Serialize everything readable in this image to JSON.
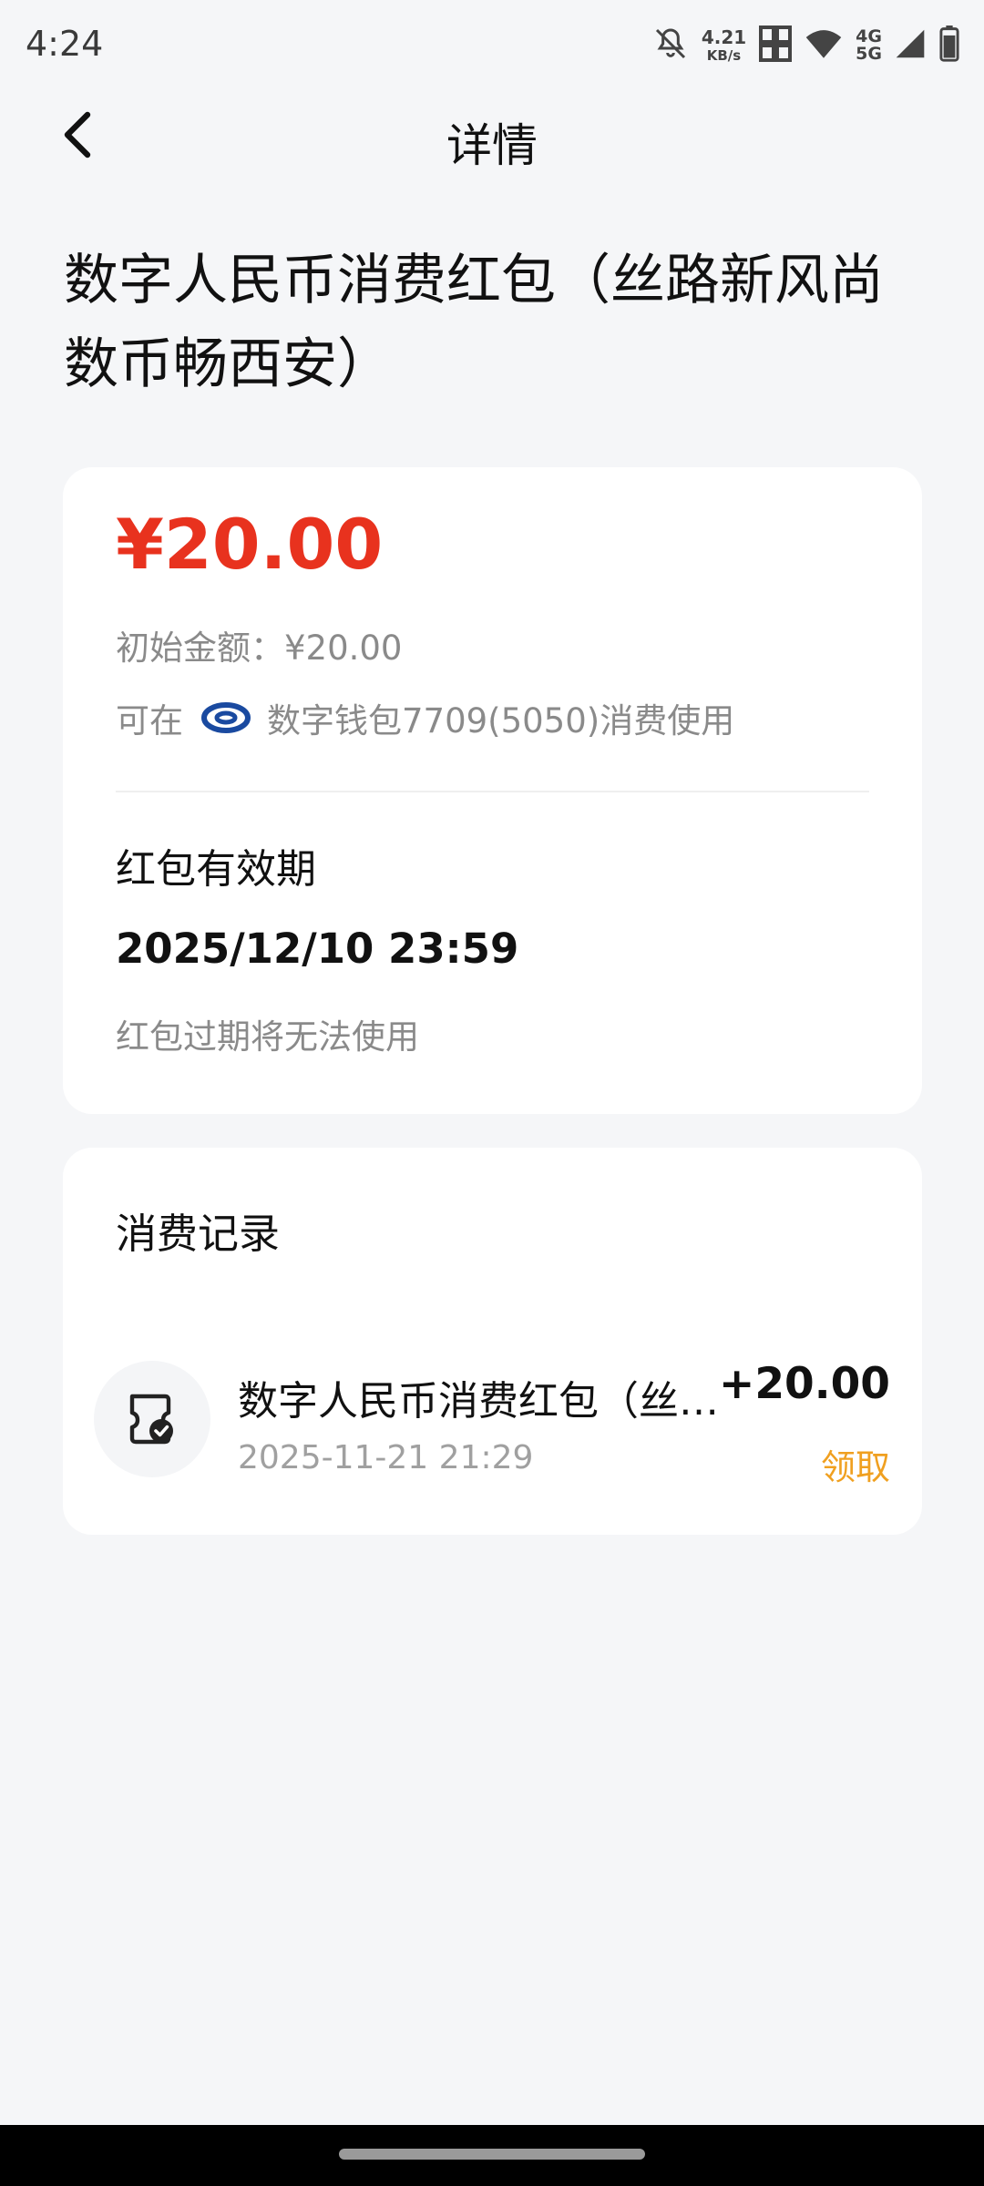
{
  "status_bar": {
    "time": "4:24",
    "net_speed_value": "4.21",
    "net_speed_unit": "KB/s",
    "network_top": "4G",
    "network_bottom": "5G",
    "icons": [
      "bell-off-icon",
      "sim-icon",
      "wifi-icon",
      "signal-icon",
      "battery-icon"
    ]
  },
  "header": {
    "title": "详情",
    "back_icon": "chevron-left-icon"
  },
  "page_title": "数字人民币消费红包（丝路新风尚数币畅西安）",
  "summary": {
    "amount": "¥20.00",
    "initial_amount": "初始金额：¥20.00",
    "usable_prefix": "可在",
    "usable_wallet": "数字钱包7709(5050)消费使用",
    "bank_icon": "bank-logo-icon",
    "validity_label": "红包有效期",
    "validity_date": "2025/12/10 23:59",
    "validity_note": "红包过期将无法使用"
  },
  "records": {
    "title": "消费记录",
    "items": [
      {
        "name": "数字人民币消费红包（丝路新风尚数币畅西安）",
        "amount": "+20.00",
        "time": "2025-11-21 21:29",
        "status": "领取",
        "icon": "voucher-check-icon"
      }
    ]
  },
  "colors": {
    "amount_red": "#e8321e",
    "status_orange": "#f0a020",
    "page_bg": "#f5f6f8",
    "bank_blue": "#1a4aa0"
  }
}
